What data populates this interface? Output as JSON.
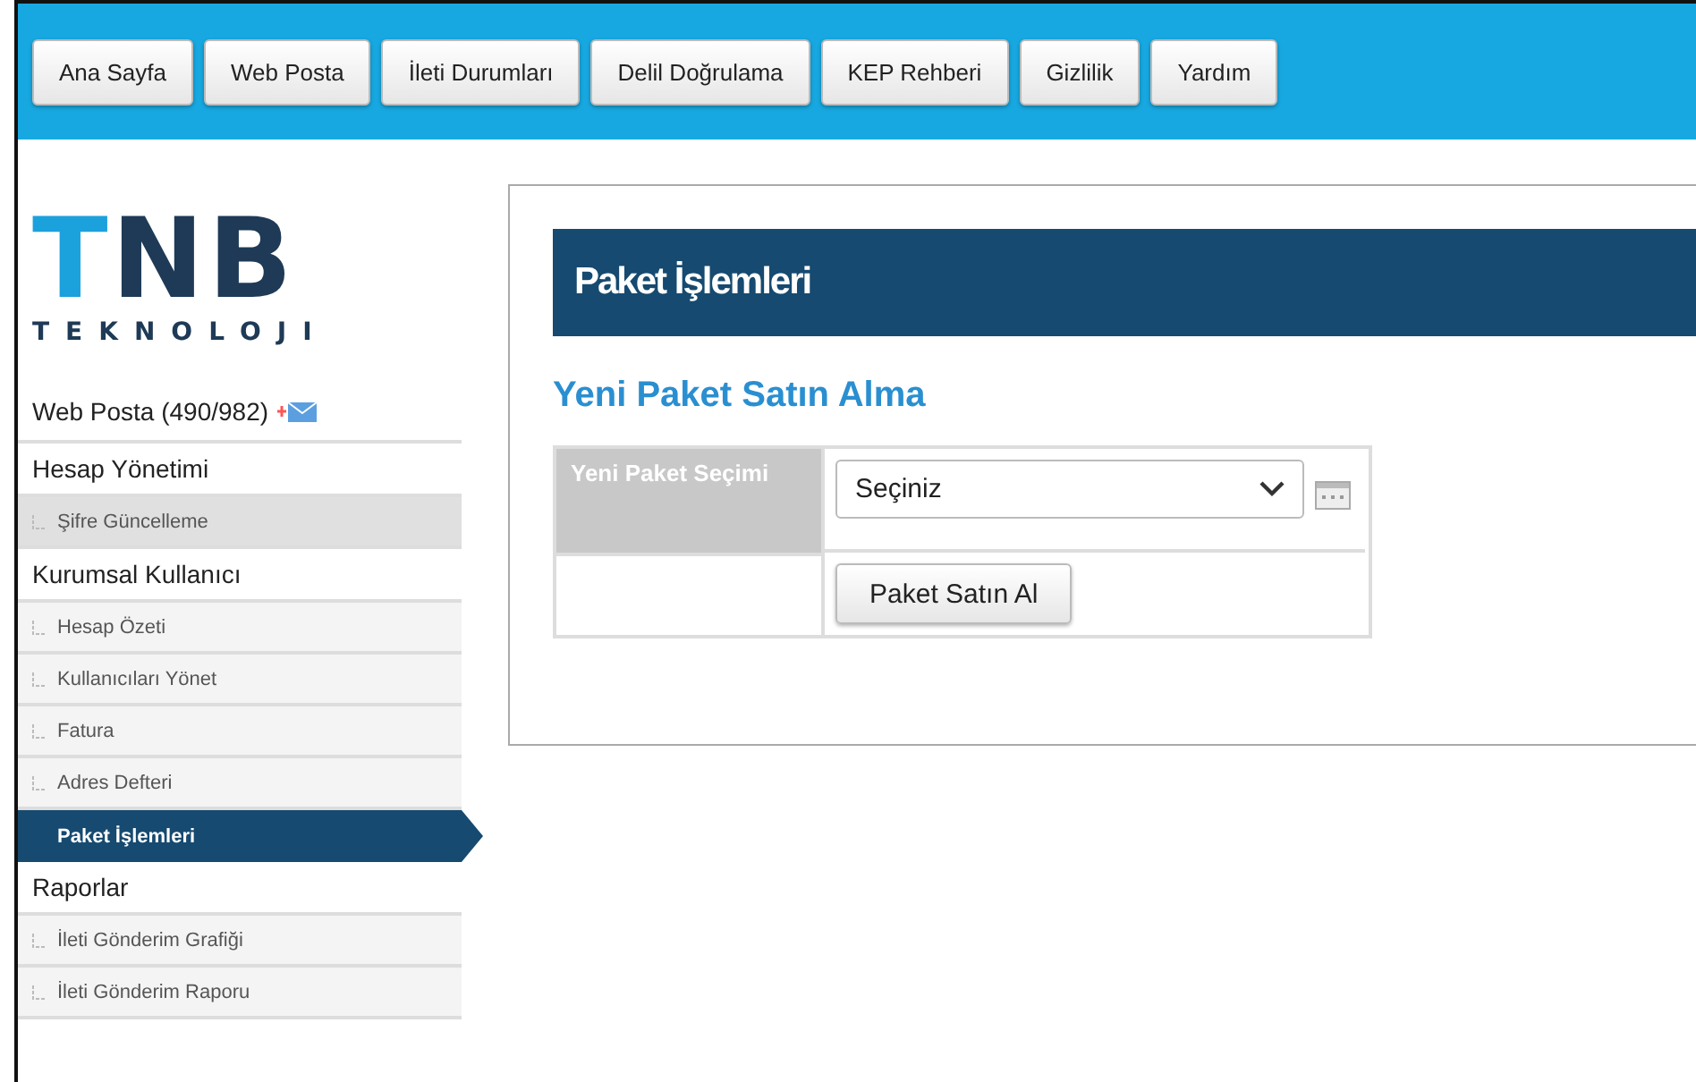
{
  "nav": [
    {
      "label": "Ana Sayfa"
    },
    {
      "label": "Web Posta"
    },
    {
      "label": "İleti Durumları"
    },
    {
      "label": "Delil Doğrulama"
    },
    {
      "label": "KEP Rehberi"
    },
    {
      "label": "Gizlilik"
    },
    {
      "label": "Yardım"
    }
  ],
  "logo": {
    "mark": "TNB",
    "tagline": "TEKNOLOJI"
  },
  "sidebar": {
    "items": [
      {
        "kind": "mail",
        "label": "Web Posta (490/982)",
        "selected": false
      },
      {
        "kind": "section",
        "label": "Hesap Yönetimi",
        "selected": false
      },
      {
        "kind": "sub",
        "label": "Şifre Güncelleme",
        "selected": false,
        "shaded": true
      },
      {
        "kind": "section",
        "label": "Kurumsal Kullanıcı",
        "selected": false
      },
      {
        "kind": "sub",
        "label": "Hesap Özeti",
        "selected": false,
        "shaded": false
      },
      {
        "kind": "sub",
        "label": "Kullanıcıları Yönet",
        "selected": false,
        "shaded": false
      },
      {
        "kind": "sub",
        "label": "Fatura",
        "selected": false,
        "shaded": false
      },
      {
        "kind": "sub",
        "label": "Adres Defteri",
        "selected": false,
        "shaded": false
      },
      {
        "kind": "sub",
        "label": "Paket İşlemleri",
        "selected": true,
        "shaded": false
      },
      {
        "kind": "section",
        "label": "Raporlar",
        "selected": false
      },
      {
        "kind": "sub",
        "label": "İleti Gönderim Grafiği",
        "selected": false,
        "shaded": false
      },
      {
        "kind": "sub",
        "label": "İleti Gönderim Raporu",
        "selected": false,
        "shaded": false
      }
    ]
  },
  "panel": {
    "title": "Paket İşlemleri",
    "subtitle": "Yeni Paket Satın Alma",
    "field_label": "Yeni Paket Seçimi",
    "select": {
      "value": "Seçiniz"
    },
    "button": "Paket Satın Al"
  }
}
